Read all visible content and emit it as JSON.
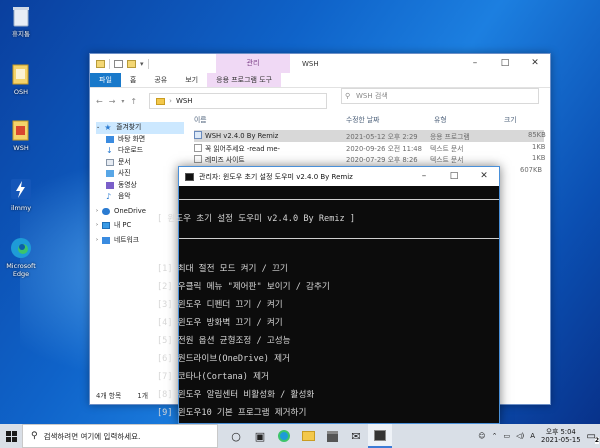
{
  "desktop": {
    "icons": [
      {
        "label": "휴지통"
      },
      {
        "label": "OSH"
      },
      {
        "label": "WSH"
      },
      {
        "label": "ilmmy"
      },
      {
        "label": "Microsoft Edge"
      }
    ]
  },
  "explorer": {
    "title": "WSH",
    "manage_tab": "관리",
    "ribbon_tabs": [
      "파일",
      "홈",
      "공유",
      "보기",
      "응용 프로그램 도구"
    ],
    "address": "WSH",
    "search_placeholder": "WSH 검색",
    "columns": {
      "name": "이름",
      "date": "수정한 날짜",
      "type": "유형",
      "size": "크기"
    },
    "sidebar": [
      "즐겨찾기",
      "바탕 화면",
      "다운로드",
      "문서",
      "사진",
      "동영상",
      "음악",
      "OneDrive",
      "내 PC",
      "네트워크"
    ],
    "files": [
      {
        "name": "WSH v2.4.0 By Remiz",
        "date": "2021-05-12 오후 2:29",
        "type": "응용 프로그램",
        "size": "85KB"
      },
      {
        "name": "꼭 읽어주세요 -read me-",
        "date": "2020-09-26 오전 11:48",
        "type": "텍스트 문서",
        "size": "1KB"
      },
      {
        "name": "레미즈 사이트",
        "date": "2020-07-29 오후 8:26",
        "type": "텍스트 문서",
        "size": "1KB"
      },
      {
        "name": "",
        "date": "",
        "type": "",
        "size": "607KB"
      }
    ],
    "status_count": "4개 항목",
    "status_sel": "1개"
  },
  "console": {
    "title": "관리자:  윈도우 초기 설정 도우미 v2.4.0 By Remiz",
    "header": "[ 윈도우 초기 설정 도우미 v2.4.0 By Remiz ]",
    "items": [
      "[1] 최대 절전 모드 켜기 / 끄기",
      "[2] 우클릭 메뉴 \"제어판\" 보이기 / 감추기",
      "[3] 윈도우 디펜더 끄기 / 켜기",
      "[4] 윈도우 방화벽 끄기 / 켜기",
      "[5] 전원 옵션 균형조정 / 고성능",
      "[6] 원드라이브(OneDrive) 제거",
      "[7] 코타나(Cortana) 제거",
      "[8] 윈도우 알림센터 비활성화 / 활성화",
      "[9] 윈도우10 기본 프로그램 제거하기"
    ]
  },
  "taskbar": {
    "search_placeholder": "검색하려면 여기에 입력하세요.",
    "ime": "A",
    "time": "오후 5:04",
    "date": "2021-05-15",
    "notification_count": "2"
  }
}
